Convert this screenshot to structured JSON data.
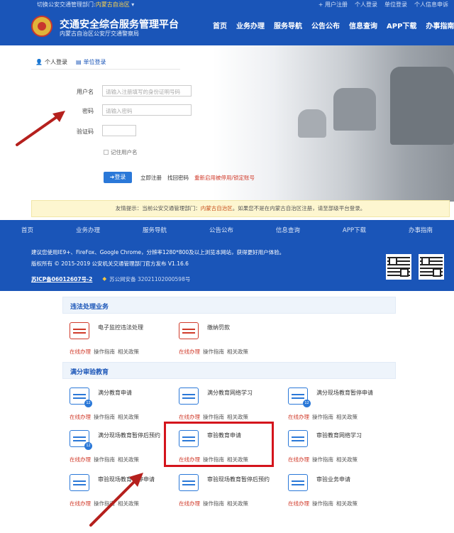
{
  "top_strip": {
    "dept_prefix": "切换公安交通管理部门:",
    "dept_region": "内蒙古自治区",
    "links": [
      "+ 用户注册",
      "个人登录",
      "单位登录",
      "个人信息申诉"
    ]
  },
  "brand": {
    "title": "交通安全综合服务管理平台",
    "subtitle": "内蒙古自治区公安厅交通警察局"
  },
  "main_nav": [
    "首页",
    "业务办理",
    "服务导航",
    "公告公布",
    "信息查询",
    "APP下载",
    "办事指南"
  ],
  "login": {
    "tabs": [
      "个人登录",
      "单位登录"
    ],
    "username_label": "用户名",
    "username_placeholder": "请输入注册填写的身份证明号码",
    "password_label": "密码",
    "password_placeholder": "请输入密码",
    "captcha_label": "验证码",
    "remember_label": "记住用户名",
    "login_button": "登录",
    "register_link": "立即注册",
    "forgot_link": "找回密码",
    "reactivate_link": "重新启用被停用/锁定账号"
  },
  "notice": {
    "prefix": "友情提示：当前公安交通管理部门：",
    "region": "内蒙古自治区",
    "suffix": "。如果您不是在内蒙古自治区注册，请至部级平台登录。"
  },
  "footer": {
    "nav": [
      "首页",
      "业务办理",
      "服务导航",
      "公告公布",
      "信息查询",
      "APP下载",
      "办事指南"
    ],
    "browser_note": "建议您使用IE9+、FireFox、Google Chrome，分辨率1280*800及以上浏览本网站，获得更好用户体验。",
    "copyright": "版权所有 © 2015-2019 公安机关交通管理部门官方发布 V1.16.6",
    "icp": "苏ICP备06012607号-2",
    "police_record": "苏公网安备 32021102000598号"
  },
  "services": {
    "sections": [
      {
        "title": "违法处理业务",
        "items": [
          {
            "name": "电子监控违法处理",
            "icon": "camera-icon",
            "badge": ""
          },
          {
            "name": "缴纳罚款",
            "icon": "fine-payment-icon",
            "badge": ""
          }
        ]
      },
      {
        "title": "满分审验教育",
        "items": [
          {
            "name": "满分教育申请",
            "icon": "document-icon",
            "badge": "12"
          },
          {
            "name": "满分教育网络学习",
            "icon": "video-icon",
            "badge": ""
          },
          {
            "name": "满分现场教育暂停申请",
            "icon": "pause-icon",
            "badge": "12"
          },
          {
            "name": "满分现场教育暂停后预约",
            "icon": "clock-icon",
            "badge": "12"
          },
          {
            "name": "审验教育申请",
            "icon": "document-icon",
            "badge": ""
          },
          {
            "name": "审验教育网络学习",
            "icon": "video-icon",
            "badge": ""
          },
          {
            "name": "审验现场教育暂停申请",
            "icon": "pause-icon",
            "badge": ""
          },
          {
            "name": "审验现场教育暂停后预约",
            "icon": "clock-icon",
            "badge": ""
          },
          {
            "name": "审验业务申请",
            "icon": "form-icon",
            "badge": ""
          }
        ]
      }
    ],
    "actions": {
      "online": "在线办理",
      "guide": "操作指南",
      "policy": "相关政策"
    }
  },
  "colors": {
    "brand_blue": "#1a55b8",
    "accent_red": "#d03a2a",
    "highlight_red": "#d4141c"
  }
}
